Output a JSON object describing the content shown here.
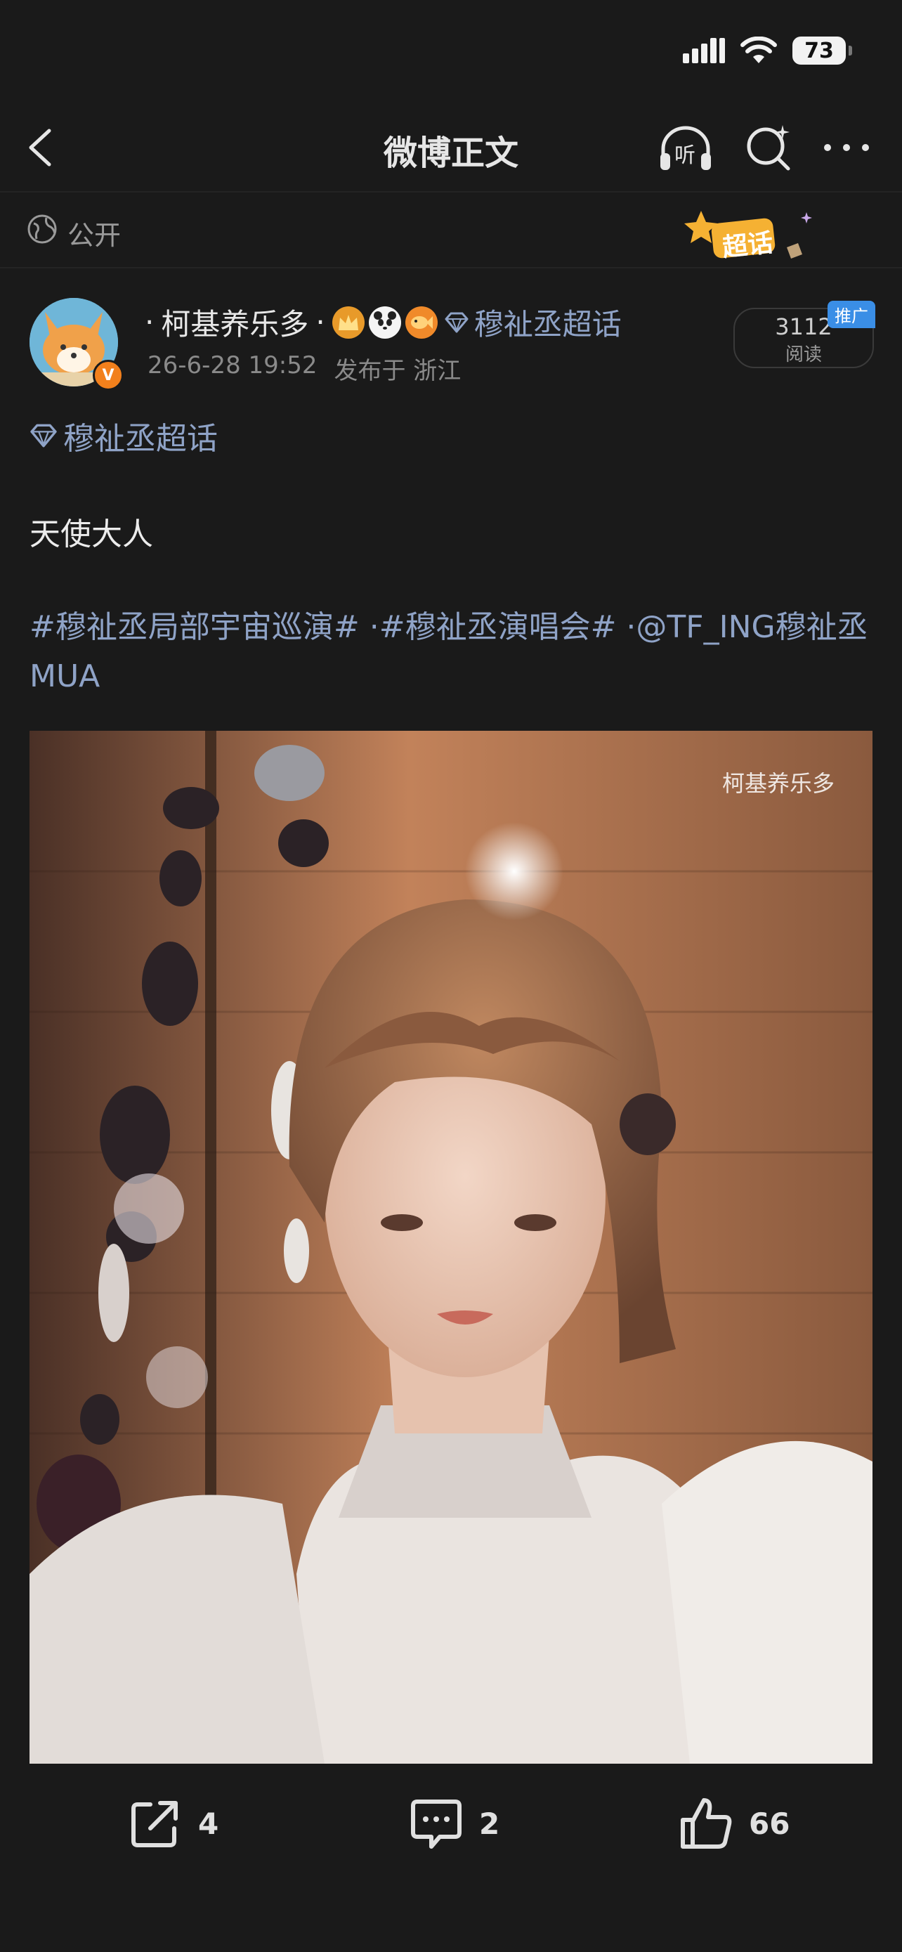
{
  "status_bar": {
    "battery": "73"
  },
  "nav": {
    "title": "微博正文",
    "listen_label": "听"
  },
  "visibility": {
    "label": "公开",
    "badge_text": "超话"
  },
  "post": {
    "author": {
      "name_prefix": "·",
      "name": "柯基养乐多",
      "name_suffix": "·",
      "topic": "穆祉丞超话",
      "verified_mark": "V"
    },
    "time": "26-6-28 19:52",
    "location": "发布于 浙江",
    "read_count": "3112",
    "read_label": "阅读",
    "promo_tag": "推广",
    "topic_link": "穆祉丞超话",
    "text": "天使大人",
    "hashtags_line": "#穆祉丞局部宇宙巡演# ·#穆祉丞演唱会# ·@TF_ING穆祉丞 MUA",
    "image_watermark": "柯基养乐多"
  },
  "actions": {
    "share_count": "4",
    "comment_count": "2",
    "like_count": "66"
  },
  "colors": {
    "background": "#1a1a1a",
    "link": "#8fa3c7",
    "verified": "#f2801c",
    "promo": "#3a8ee6"
  }
}
